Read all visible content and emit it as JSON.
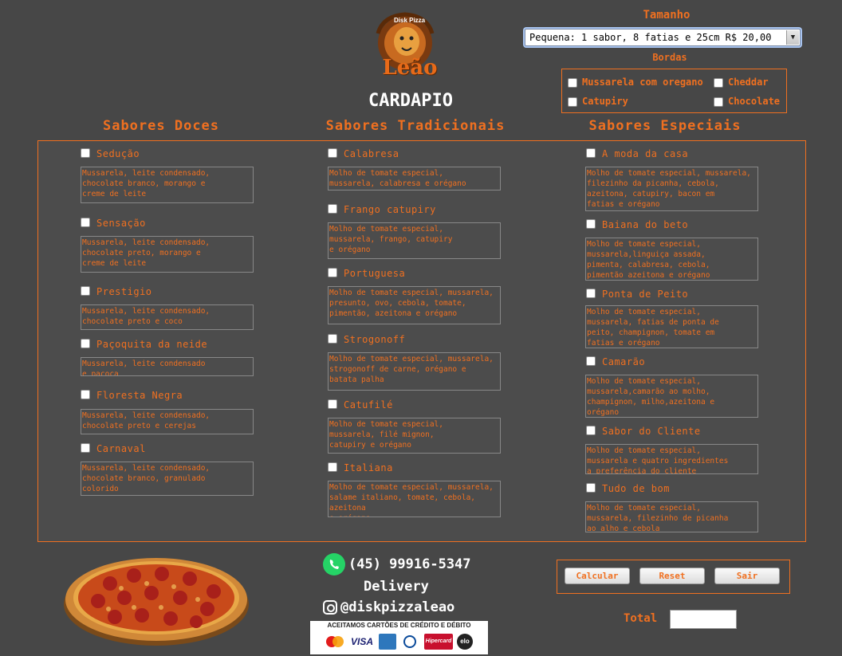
{
  "logo": {
    "top_text": "Disk Pizza",
    "brand": "Leão"
  },
  "header": {
    "title": "CARDAPIO"
  },
  "tamanho": {
    "label": "Tamanho",
    "selected": "Pequena: 1 sabor, 8 fatias e 25cm R$ 20,00"
  },
  "bordas": {
    "label": "Bordas",
    "items": [
      "Mussarela com oregano",
      "Cheddar",
      "Catupiry",
      "Chocolate"
    ]
  },
  "columns": {
    "doces": {
      "title": "Sabores Doces",
      "items": [
        {
          "name": "Sedução",
          "desc": "Mussarela, leite condensado,\nchocolate branco, morango e\ncreme de leite"
        },
        {
          "name": "Sensação",
          "desc": "Mussarela, leite condensado,\nchocolate preto, morango e\ncreme de leite"
        },
        {
          "name": "Prestigio",
          "desc": "Mussarela, leite condensado,\nchocolate preto e coco"
        },
        {
          "name": "Paçoquita da neide",
          "desc": "Mussarela, leite condensado\ne paçoca"
        },
        {
          "name": "Floresta Negra",
          "desc": "Mussarela, leite condensado,\nchocolate preto e cerejas"
        },
        {
          "name": "Carnaval",
          "desc": "Mussarela, leite condensado,\nchocolate branco, granulado\ncolorido"
        }
      ]
    },
    "tradicionais": {
      "title": "Sabores Tradicionais",
      "items": [
        {
          "name": "Calabresa",
          "desc": "Molho de tomate especial,\nmussarela, calabresa e orégano"
        },
        {
          "name": "Frango catupiry",
          "desc": "Molho de tomate especial,\nmussarela, frango, catupiry\ne orégano"
        },
        {
          "name": "Portuguesa",
          "desc": "Molho de tomate especial, mussarela,\npresunto, ovo, cebola, tomate,\npimentão, azeitona e orégano"
        },
        {
          "name": "Strogonoff",
          "desc": "Molho de tomate especial, mussarela,\nstrogonoff de carne, orégano e\nbatata palha"
        },
        {
          "name": "Catufilé",
          "desc": "Molho de tomate especial,\nmussarela, filé mignon,\ncatupiry e orégano"
        },
        {
          "name": "Italiana",
          "desc": "Molho de tomate especial, mussarela,\nsalame italiano, tomate, cebola, azeitona\ne orégano"
        }
      ]
    },
    "especiais": {
      "title": "Sabores Especiais",
      "items": [
        {
          "name": "A moda da casa",
          "desc": "Molho de tomate especial, mussarela,\nfilezinho da picanha, cebola,\nazeitona, catupiry, bacon em\nfatias e orégano"
        },
        {
          "name": "Baiana do beto",
          "desc": "Molho de tomate especial,\nmussarela,linguiça assada,\npimenta, calabresa, cebola,\npimentão azeitona e orégano"
        },
        {
          "name": "Ponta de Peito",
          "desc": "Molho de tomate especial,\nmussarela, fatias de ponta de\npeito, champignon, tomate em\nfatias e orégano"
        },
        {
          "name": "Camarão",
          "desc": "Molho de tomate especial,\nmussarela,camarão ao molho,\nchampignon, milho,azeitona e\norégano"
        },
        {
          "name": "Sabor do Cliente",
          "desc": "Molho de tomate especial,\nmussarela e quatro ingredientes\na preferência do cliente"
        },
        {
          "name": "Tudo de bom",
          "desc": "Molho de tomate especial,\nmussarela, filezinho de picanha\nao alho e cebola"
        }
      ]
    }
  },
  "contact": {
    "phone": "(45) 99916-5347",
    "delivery": "Delivery",
    "instagram": "@diskpizzaleao"
  },
  "cards": {
    "title": "ACEITAMOS CARTÕES DE CRÉDITO E DÉBITO",
    "brands": [
      "VISA",
      "Hipercard",
      "elo"
    ]
  },
  "buttons": {
    "calcular": "Calcular",
    "reset": "Reset",
    "sair": "Sair"
  },
  "total": {
    "label": "Total",
    "value": ""
  },
  "colors": {
    "accent": "#f07020",
    "background": "#474747"
  }
}
